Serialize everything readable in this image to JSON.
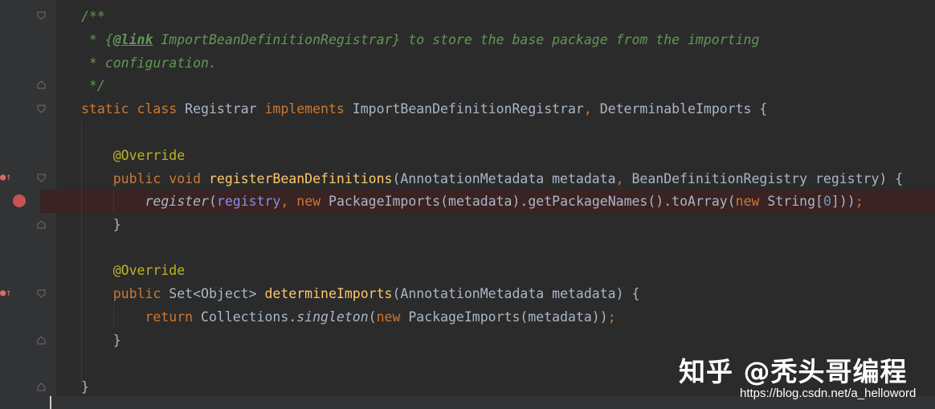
{
  "code": {
    "lines": [
      {
        "tokens": [
          {
            "t": "/**",
            "c": "c-comment"
          }
        ]
      },
      {
        "tokens": [
          {
            "t": " * {",
            "c": "c-comment"
          },
          {
            "t": "@link",
            "c": "c-link"
          },
          {
            "t": " ImportBeanDefinitionRegistrar",
            "c": "c-comment"
          },
          {
            "t": "} to store the base package from the importing",
            "c": "c-comment"
          }
        ]
      },
      {
        "tokens": [
          {
            "t": " * configuration.",
            "c": "c-comment"
          }
        ]
      },
      {
        "tokens": [
          {
            "t": " */",
            "c": "c-comment"
          }
        ]
      },
      {
        "tokens": [
          {
            "t": "static ",
            "c": "c-kw"
          },
          {
            "t": "class ",
            "c": "c-kw"
          },
          {
            "t": "Registrar ",
            "c": "c-plain"
          },
          {
            "t": "implements ",
            "c": "c-kw"
          },
          {
            "t": "ImportBeanDefinitionRegistrar",
            "c": "c-plain"
          },
          {
            "t": ", ",
            "c": "c-kw"
          },
          {
            "t": "DeterminableImports {",
            "c": "c-plain"
          }
        ]
      },
      {
        "tokens": []
      },
      {
        "tokens": [
          {
            "t": "    @Override",
            "c": "c-ann"
          }
        ]
      },
      {
        "tokens": [
          {
            "t": "    public ",
            "c": "c-kw"
          },
          {
            "t": "void ",
            "c": "c-kw"
          },
          {
            "t": "registerBeanDefinitions",
            "c": "c-method"
          },
          {
            "t": "(AnnotationMetadata metadata",
            "c": "c-plain"
          },
          {
            "t": ", ",
            "c": "c-kw"
          },
          {
            "t": "BeanDefinitionRegistry registry) {",
            "c": "c-plain"
          }
        ]
      },
      {
        "tokens": [
          {
            "t": "        ",
            "c": "c-plain"
          },
          {
            "t": "register",
            "c": "c-italic"
          },
          {
            "t": "(",
            "c": "c-plain"
          },
          {
            "t": "registry",
            "c": "c-param2"
          },
          {
            "t": ", ",
            "c": "c-kw"
          },
          {
            "t": "new ",
            "c": "c-kw"
          },
          {
            "t": "PackageImports(metadata).getPackageNames().toArray(",
            "c": "c-plain"
          },
          {
            "t": "new ",
            "c": "c-kw"
          },
          {
            "t": "String[",
            "c": "c-plain"
          },
          {
            "t": "0",
            "c": "c-num"
          },
          {
            "t": "]))",
            "c": "c-plain"
          },
          {
            "t": ";",
            "c": "c-kw"
          }
        ]
      },
      {
        "tokens": [
          {
            "t": "    }",
            "c": "c-plain"
          }
        ]
      },
      {
        "tokens": []
      },
      {
        "tokens": [
          {
            "t": "    @Override",
            "c": "c-ann"
          }
        ]
      },
      {
        "tokens": [
          {
            "t": "    public ",
            "c": "c-kw"
          },
          {
            "t": "Set<Object> ",
            "c": "c-plain"
          },
          {
            "t": "determineImports",
            "c": "c-method"
          },
          {
            "t": "(AnnotationMetadata metadata) {",
            "c": "c-plain"
          }
        ]
      },
      {
        "tokens": [
          {
            "t": "        return ",
            "c": "c-kw"
          },
          {
            "t": "Collections.",
            "c": "c-plain"
          },
          {
            "t": "singleton",
            "c": "c-italic"
          },
          {
            "t": "(",
            "c": "c-plain"
          },
          {
            "t": "new ",
            "c": "c-kw"
          },
          {
            "t": "PackageImports(metadata))",
            "c": "c-plain"
          },
          {
            "t": ";",
            "c": "c-kw"
          }
        ]
      },
      {
        "tokens": [
          {
            "t": "    }",
            "c": "c-plain"
          }
        ]
      },
      {
        "tokens": []
      },
      {
        "tokens": [
          {
            "t": "}",
            "c": "c-plain"
          }
        ]
      }
    ]
  },
  "watermark": {
    "brand": "知乎 @秃头哥编程",
    "url": "https://blog.csdn.net/a_helloword"
  },
  "icons": {
    "breakpoint": "breakpoint-icon",
    "fold": "fold-marker-icon",
    "override": "override-gutter-icon"
  },
  "colors": {
    "background": "#2b2b2b",
    "gutter": "#313335",
    "keyword": "#cc7832",
    "comment": "#629755",
    "annotation": "#bbb529",
    "method": "#ffc66d",
    "breakpoint": "#c75450"
  }
}
